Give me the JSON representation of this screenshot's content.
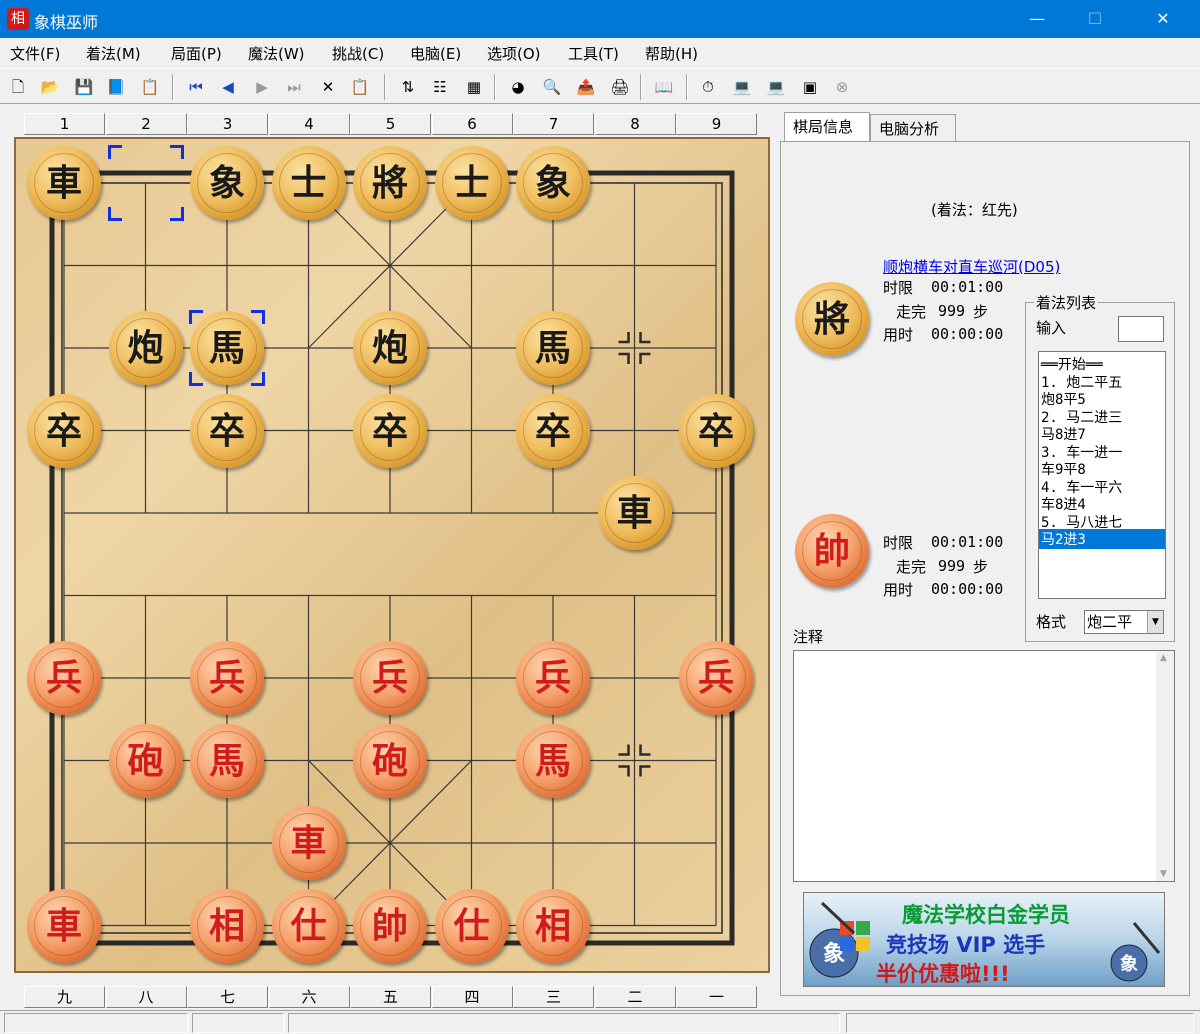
{
  "window": {
    "title": "象棋巫师",
    "app_icon_text": "相",
    "minimize": "—",
    "maximize": "☐",
    "close": "✕"
  },
  "menu": [
    "文件(F)",
    "着法(M)",
    "局面(P)",
    "魔法(W)",
    "挑战(C)",
    "电脑(E)",
    "选项(O)",
    "工具(T)",
    "帮助(H)"
  ],
  "toolbar": {
    "buttons": [
      "new-file-icon",
      "open-folder-icon",
      "save-icon",
      "book-icon",
      "properties-icon",
      "first-move-icon",
      "prev-move-icon",
      "next-move-icon",
      "last-move-icon",
      "delete-icon",
      "paste-icon",
      "flip-board-icon",
      "move-tree-icon",
      "calculator-icon",
      "color-wheel-icon",
      "search-doc-icon",
      "export-icon",
      "print-icon",
      "opening-book-icon",
      "timer-icon",
      "computer-play-icon",
      "computer-analyze-icon",
      "monitor-icon",
      "stop-icon"
    ],
    "glyphs": [
      "🗋",
      "📂",
      "💾",
      "📘",
      "📋",
      "⏮",
      "◀",
      "▶",
      "⏭",
      "✕",
      "📋",
      "⇅",
      "☷",
      "▦",
      "◕",
      "🔍",
      "📤",
      "🖨",
      "📖",
      "⏱",
      "💻",
      "💻",
      "▣",
      "⊗"
    ]
  },
  "board": {
    "top_labels": [
      "1",
      "2",
      "3",
      "4",
      "5",
      "6",
      "7",
      "8",
      "9"
    ],
    "bottom_labels": [
      "九",
      "八",
      "七",
      "六",
      "五",
      "四",
      "三",
      "二",
      "一"
    ],
    "pieces": [
      {
        "char": "車",
        "side": "black",
        "col": 0,
        "row": 0
      },
      {
        "char": "象",
        "side": "black",
        "col": 2,
        "row": 0
      },
      {
        "char": "士",
        "side": "black",
        "col": 3,
        "row": 0
      },
      {
        "char": "將",
        "side": "black",
        "col": 4,
        "row": 0
      },
      {
        "char": "士",
        "side": "black",
        "col": 5,
        "row": 0
      },
      {
        "char": "象",
        "side": "black",
        "col": 6,
        "row": 0
      },
      {
        "char": "炮",
        "side": "black",
        "col": 1,
        "row": 2
      },
      {
        "char": "馬",
        "side": "black",
        "col": 2,
        "row": 2
      },
      {
        "char": "炮",
        "side": "black",
        "col": 4,
        "row": 2
      },
      {
        "char": "馬",
        "side": "black",
        "col": 6,
        "row": 2
      },
      {
        "char": "卒",
        "side": "black",
        "col": 0,
        "row": 3
      },
      {
        "char": "卒",
        "side": "black",
        "col": 2,
        "row": 3
      },
      {
        "char": "卒",
        "side": "black",
        "col": 4,
        "row": 3
      },
      {
        "char": "卒",
        "side": "black",
        "col": 6,
        "row": 3
      },
      {
        "char": "卒",
        "side": "black",
        "col": 8,
        "row": 3
      },
      {
        "char": "車",
        "side": "black",
        "col": 7,
        "row": 4
      },
      {
        "char": "兵",
        "side": "red",
        "col": 0,
        "row": 6
      },
      {
        "char": "兵",
        "side": "red",
        "col": 2,
        "row": 6
      },
      {
        "char": "兵",
        "side": "red",
        "col": 4,
        "row": 6
      },
      {
        "char": "兵",
        "side": "red",
        "col": 6,
        "row": 6
      },
      {
        "char": "兵",
        "side": "red",
        "col": 8,
        "row": 6
      },
      {
        "char": "砲",
        "side": "red",
        "col": 1,
        "row": 7
      },
      {
        "char": "馬",
        "side": "red",
        "col": 2,
        "row": 7
      },
      {
        "char": "砲",
        "side": "red",
        "col": 4,
        "row": 7
      },
      {
        "char": "馬",
        "side": "red",
        "col": 6,
        "row": 7
      },
      {
        "char": "車",
        "side": "red",
        "col": 3,
        "row": 8
      },
      {
        "char": "車",
        "side": "red",
        "col": 0,
        "row": 9
      },
      {
        "char": "相",
        "side": "red",
        "col": 2,
        "row": 9
      },
      {
        "char": "仕",
        "side": "red",
        "col": 3,
        "row": 9
      },
      {
        "char": "帥",
        "side": "red",
        "col": 4,
        "row": 9
      },
      {
        "char": "仕",
        "side": "red",
        "col": 5,
        "row": 9
      },
      {
        "char": "相",
        "side": "red",
        "col": 6,
        "row": 9
      }
    ],
    "last_move_markers": [
      {
        "col": 1,
        "row": 0
      },
      {
        "col": 2,
        "row": 2
      }
    ]
  },
  "tabs": [
    "棋局信息",
    "电脑分析"
  ],
  "info": {
    "move_hint": "(着法：红先)",
    "opening_link": "顺炮横车对直车巡河(D05)",
    "black": {
      "piece": "將",
      "time_limit_label": "时限",
      "time_limit": "00:01:00",
      "moves_label": "走完",
      "moves_value": "999",
      "moves_unit": "步",
      "used_label": "用时",
      "used": "00:00:00"
    },
    "red": {
      "piece": "帥",
      "time_limit_label": "时限",
      "time_limit": "00:01:00",
      "moves_label": "走完",
      "moves_value": "999",
      "moves_unit": "步",
      "used_label": "用时",
      "used": "00:00:00"
    },
    "movelist_title": "着法列表",
    "input_label": "输入",
    "moves": [
      "══开始══",
      "1. 炮二平五",
      "   炮8平5",
      "2. 马二进三",
      "   马8进7",
      "3. 车一进一",
      "   车9平8",
      "4. 车一平六",
      "   车8进4",
      "5. 马八进七",
      "   马2进3"
    ],
    "selected_move_index": 10,
    "format_label": "格式",
    "format_value": "炮二平",
    "notes_label": "注释"
  },
  "banner": {
    "line1": "魔法学校白金学员",
    "line2": "竞技场 VIP 选手",
    "line3": "半价优惠啦!!!"
  }
}
